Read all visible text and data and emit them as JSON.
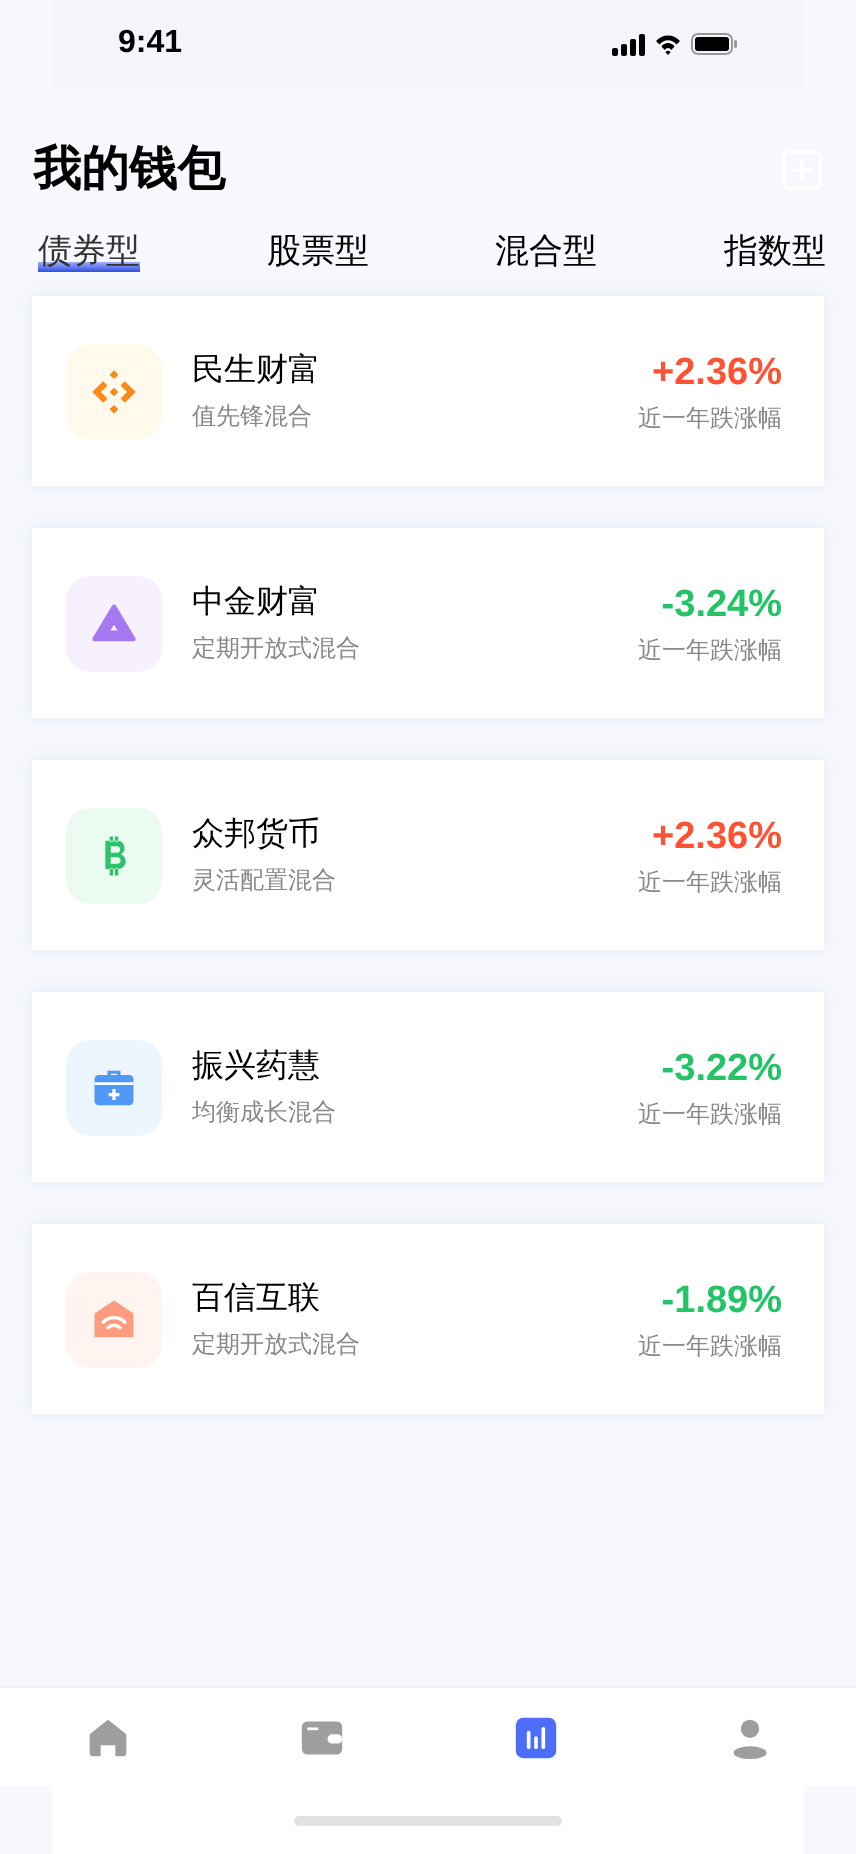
{
  "status_bar": {
    "time": "9:41"
  },
  "title": "我的钱包",
  "tabs": [
    {
      "label": "债券型",
      "selected": true
    },
    {
      "label": "股票型",
      "selected": false
    },
    {
      "label": "混合型",
      "selected": false
    },
    {
      "label": "指数型",
      "selected": false
    }
  ],
  "funds": [
    {
      "kind": "diamond",
      "name": "民生财富",
      "subtitle": "值先锋混合",
      "change": "+2.36%",
      "color": "#ff5233",
      "change_label": "近一年跌涨幅"
    },
    {
      "kind": "triangle",
      "name": "中金财富",
      "subtitle": "定期开放式混合",
      "change": "-3.24%",
      "color": "#22c466",
      "change_label": "近一年跌涨幅"
    },
    {
      "kind": "coin",
      "name": "众邦货币",
      "subtitle": "灵活配置混合",
      "change": "+2.36%",
      "color": "#ff5233",
      "change_label": "近一年跌涨幅"
    },
    {
      "kind": "medkit",
      "name": "振兴药慧",
      "subtitle": "均衡成长混合",
      "change": "-3.22%",
      "color": "#22c466",
      "change_label": "近一年跌涨幅"
    },
    {
      "kind": "house",
      "name": "百信互联",
      "subtitle": "定期开放式混合",
      "change": "-1.89%",
      "color": "#22c466",
      "change_label": "近一年跌涨幅"
    }
  ],
  "nav": [
    {
      "kind": "home",
      "selected": false
    },
    {
      "kind": "wallet",
      "selected": false
    },
    {
      "kind": "chart",
      "selected": true
    },
    {
      "kind": "profile",
      "selected": false
    }
  ]
}
